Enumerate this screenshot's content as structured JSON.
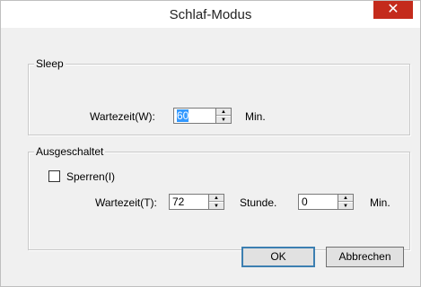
{
  "window": {
    "title": "Schlaf-Modus",
    "close_symbol": "✕"
  },
  "sleep": {
    "group_label": "Sleep",
    "wait_label": "Wartezeit(W):",
    "wait_value": "60",
    "unit": "Min."
  },
  "shutdown": {
    "group_label": "Ausgeschaltet",
    "lock_label": "Sperren(I)",
    "lock_checked": false,
    "wait_label": "Wartezeit(T):",
    "hours_value": "72",
    "hours_unit": "Stunde.",
    "minutes_value": "0",
    "minutes_unit": "Min."
  },
  "buttons": {
    "ok": "OK",
    "cancel": "Abbrechen"
  }
}
